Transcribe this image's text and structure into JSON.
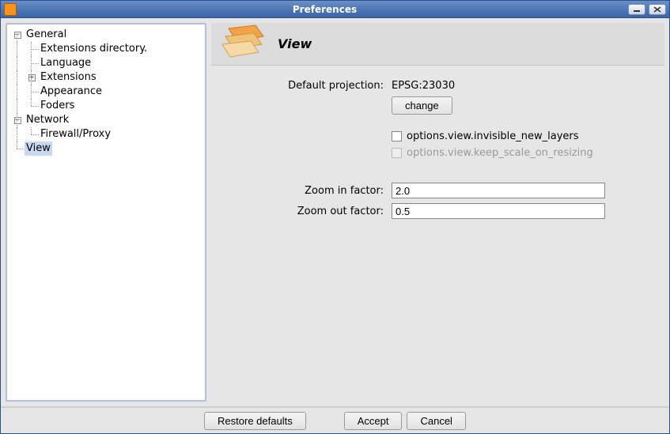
{
  "window": {
    "title": "Preferences"
  },
  "tree": {
    "general": {
      "label": "General",
      "items": {
        "ext_dir": "Extensions directory.",
        "language": "Language",
        "extensions": "Extensions",
        "appearance": "Appearance",
        "folders": "Foders"
      }
    },
    "network": {
      "label": "Network",
      "items": {
        "firewall": "Firewall/Proxy"
      }
    },
    "view": {
      "label": "View"
    }
  },
  "header": {
    "title": "View"
  },
  "form": {
    "proj_label": "Default projection:",
    "proj_value": "EPSG:23030",
    "change_btn": "change",
    "opt_invisible": "options.view.invisible_new_layers",
    "opt_keepscale": "options.view.keep_scale_on_resizing",
    "zoom_in_label": "Zoom in factor:",
    "zoom_in_value": "2.0",
    "zoom_out_label": "Zoom out factor:",
    "zoom_out_value": "0.5"
  },
  "buttons": {
    "restore": "Restore defaults",
    "accept": "Accept",
    "cancel": "Cancel"
  }
}
